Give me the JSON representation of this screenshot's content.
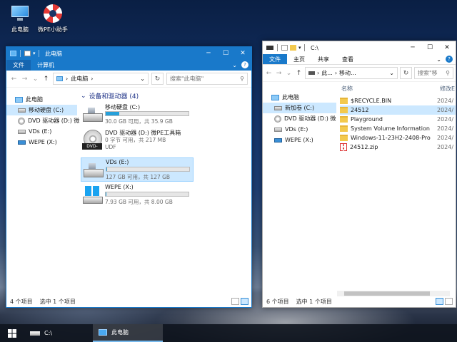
{
  "desktop": {
    "icons": [
      {
        "label": "此电脑",
        "icon": "computer-icon"
      },
      {
        "label": "微PE小助手",
        "icon": "lifebuoy-icon"
      }
    ]
  },
  "left_window": {
    "title": "此电脑",
    "tabs": [
      "文件",
      "计算机"
    ],
    "address": {
      "path": "此电脑",
      "sep": "›",
      "search_placeholder": "搜索\"此电脑\""
    },
    "nav": [
      {
        "label": "此电脑",
        "icon": "computer-icon"
      },
      {
        "label": "移动硬盘 (C:)",
        "icon": "hard-drive-icon"
      },
      {
        "label": "DVD 驱动器 (D:) 微",
        "icon": "dvd-drive-icon"
      },
      {
        "label": "VDs (E:)",
        "icon": "hard-drive-icon"
      },
      {
        "label": "WEPE (X:)",
        "icon": "usb-drive-icon"
      }
    ],
    "group_header": "设备和驱动器 (4)",
    "drives": [
      {
        "name": "移动硬盘 (C:)",
        "size": "30.0 GB 可用，共 35.9 GB",
        "used_fraction": 0.16,
        "icon": "hard-drive-icon"
      },
      {
        "name": "DVD 驱动器 (D:) 微PE工具箱",
        "size": "0 字节 可用，共 217 MB",
        "fs": "UDF",
        "icon": "dvd-rom-icon",
        "tag": "DVD-ROM"
      },
      {
        "name": "VDs (E:)",
        "size": "127 GB 可用，共 127 GB",
        "used_fraction": 0.01,
        "icon": "hard-drive-icon"
      },
      {
        "name": "WEPE (X:)",
        "size": "7.93 GB 可用，共 8.00 GB",
        "used_fraction": 0.01,
        "icon": "windows-drive-icon"
      }
    ],
    "status": {
      "count": "4 个项目",
      "selected": "选中 1 个项目"
    }
  },
  "right_window": {
    "title": "C:\\",
    "tabs": [
      "文件",
      "主页",
      "共享",
      "查看"
    ],
    "address": {
      "p1": "此...",
      "p2": "移动...",
      "search_placeholder": "搜索\"移"
    },
    "nav": [
      {
        "label": "此电脑",
        "icon": "computer-icon"
      },
      {
        "label": "新加卷 (C:)",
        "icon": "hard-drive-icon"
      },
      {
        "label": "DVD 驱动器 (D:) 微",
        "icon": "dvd-drive-icon"
      },
      {
        "label": "VDs (E:)",
        "icon": "hard-drive-icon"
      },
      {
        "label": "WEPE (X:)",
        "icon": "usb-drive-icon"
      }
    ],
    "columns": {
      "name": "名称",
      "date": "修改E"
    },
    "files": [
      {
        "name": "$RECYCLE.BIN",
        "date": "2024/",
        "icon": "folder-icon"
      },
      {
        "name": "24512",
        "date": "2024/",
        "icon": "folder-icon"
      },
      {
        "name": "Playground",
        "date": "2024/",
        "icon": "folder-icon"
      },
      {
        "name": "System Volume Information",
        "date": "2024/",
        "icon": "folder-icon"
      },
      {
        "name": "Windows-11-23H2-2408-Pro",
        "date": "2024/",
        "icon": "folder-icon"
      },
      {
        "name": "24512.zip",
        "date": "2024/",
        "icon": "zip-icon"
      }
    ],
    "status": {
      "count": "6 个项目",
      "selected": "选中 1 个项目"
    }
  },
  "taskbar": {
    "tasks": [
      {
        "label": "C:\\",
        "icon": "hard-drive-icon"
      },
      {
        "label": "此电脑",
        "icon": "computer-icon"
      }
    ]
  },
  "colors": {
    "accent": "#1979ca",
    "selection": "#cce8ff",
    "bar": "#26a0da"
  }
}
